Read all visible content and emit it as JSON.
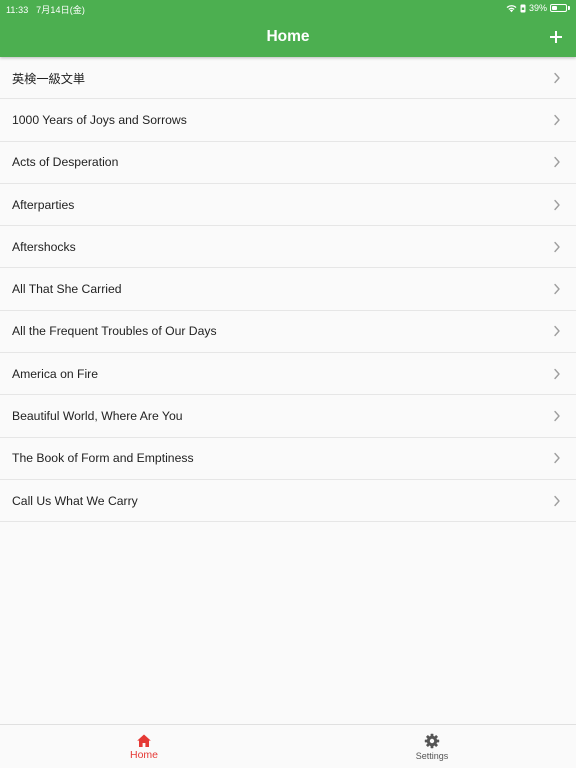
{
  "status_bar": {
    "time": "11:33",
    "date": "7月14日(金)",
    "battery_text": "39%",
    "battery_level": 0.39
  },
  "app_bar": {
    "title": "Home",
    "add_icon": "plus-icon"
  },
  "list": {
    "items": [
      {
        "label": "英検一級文単"
      },
      {
        "label": "1000 Years of Joys and Sorrows"
      },
      {
        "label": "Acts of Desperation"
      },
      {
        "label": "Afterparties"
      },
      {
        "label": "Aftershocks"
      },
      {
        "label": "All That She Carried"
      },
      {
        "label": "All the Frequent Troubles of Our Days"
      },
      {
        "label": "America on Fire"
      },
      {
        "label": "Beautiful World, Where Are You"
      },
      {
        "label": "The Book of Form and Emptiness"
      },
      {
        "label": "Call Us What We Carry"
      }
    ],
    "chevron_icon": "chevron-right-icon"
  },
  "bottom_nav": {
    "items": [
      {
        "label": "Home",
        "icon": "home-icon",
        "active": true
      },
      {
        "label": "Settings",
        "icon": "gear-icon",
        "active": false
      }
    ]
  },
  "colors": {
    "app_bar": "#4caf50",
    "active_tab": "#e53935",
    "inactive_tab": "#555555",
    "background": "#fafafa"
  }
}
